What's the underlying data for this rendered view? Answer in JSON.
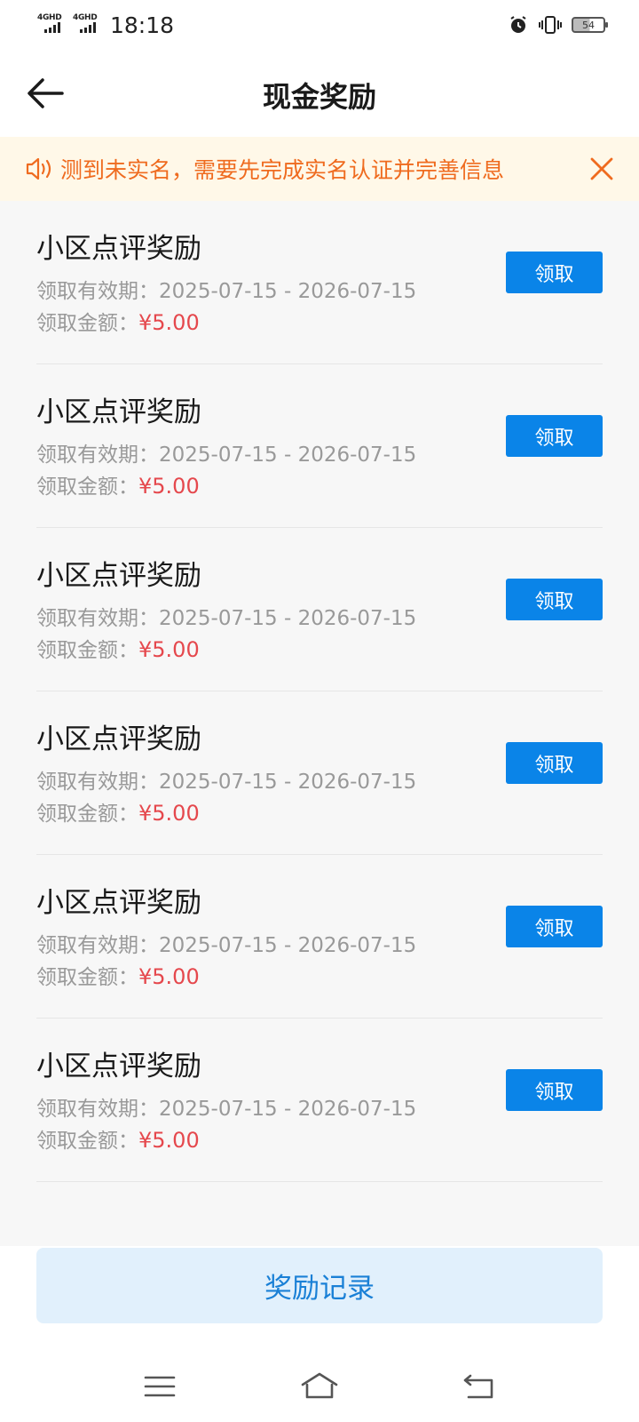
{
  "status_bar": {
    "network_1": "4GHD",
    "network_2": "4GHD",
    "time": "18:18",
    "battery": "54"
  },
  "header": {
    "title": "现金奖励"
  },
  "notice": {
    "text": "测到未实名，需要先完成实名认证并完善信息"
  },
  "rewards": {
    "items": [
      {
        "title": "小区点评奖励",
        "validity_label": "领取有效期：",
        "validity": "2025-07-15 - 2026-07-15",
        "amount_label": "领取金额：",
        "amount": "¥5.00",
        "button": "领取"
      },
      {
        "title": "小区点评奖励",
        "validity_label": "领取有效期：",
        "validity": "2025-07-15 - 2026-07-15",
        "amount_label": "领取金额：",
        "amount": "¥5.00",
        "button": "领取"
      },
      {
        "title": "小区点评奖励",
        "validity_label": "领取有效期：",
        "validity": "2025-07-15 - 2026-07-15",
        "amount_label": "领取金额：",
        "amount": "¥5.00",
        "button": "领取"
      },
      {
        "title": "小区点评奖励",
        "validity_label": "领取有效期：",
        "validity": "2025-07-15 - 2026-07-15",
        "amount_label": "领取金额：",
        "amount": "¥5.00",
        "button": "领取"
      },
      {
        "title": "小区点评奖励",
        "validity_label": "领取有效期：",
        "validity": "2025-07-15 - 2026-07-15",
        "amount_label": "领取金额：",
        "amount": "¥5.00",
        "button": "领取"
      },
      {
        "title": "小区点评奖励",
        "validity_label": "领取有效期：",
        "validity": "2025-07-15 - 2026-07-15",
        "amount_label": "领取金额：",
        "amount": "¥5.00",
        "button": "领取"
      }
    ]
  },
  "footer": {
    "records_label": "奖励记录"
  },
  "colors": {
    "accent": "#0a84e8",
    "notice_text": "#ef6b1f",
    "notice_bg": "#fff8e8",
    "amount": "#e5484d"
  },
  "icons": {
    "back": "arrow-left-icon",
    "notice": "speaker-icon",
    "close": "close-icon",
    "nav_menu": "menu-icon",
    "nav_home": "home-icon",
    "nav_back": "return-icon"
  }
}
